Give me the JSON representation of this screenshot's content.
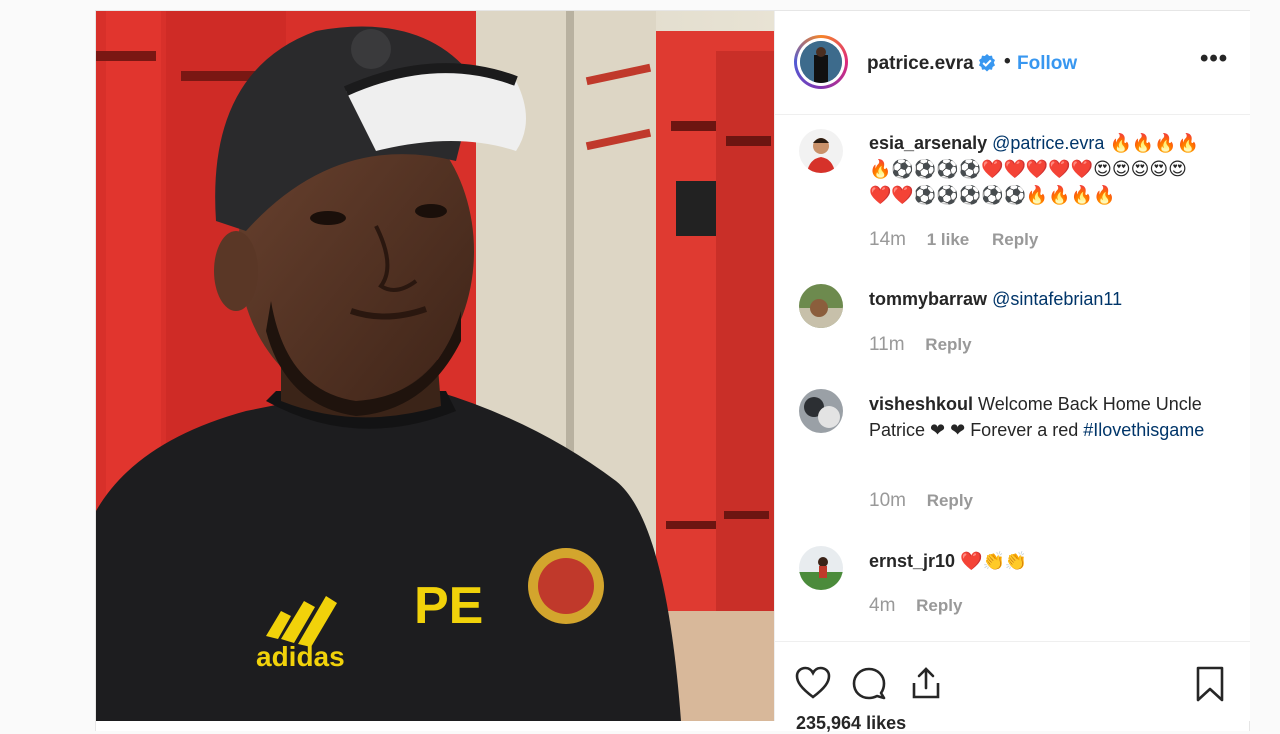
{
  "post": {
    "username": "patrice.evra",
    "follow_label": "Follow",
    "separator": "•",
    "more": "•••",
    "likes": "235,964 likes"
  },
  "comments": [
    {
      "user": "esia_arsenaly",
      "mention": "@patrice.evra",
      "text": " 🔥🔥🔥🔥 🔥⚽⚽⚽⚽❤️❤️❤️❤️❤️😍😍😍😍😍 ❤️❤️⚽⚽⚽⚽⚽🔥🔥🔥🔥",
      "time": "14m",
      "likes": "1 like",
      "reply": "Reply"
    },
    {
      "user": "tommybarraw",
      "mention": "@sintafebrian11",
      "text": "",
      "time": "11m",
      "reply": "Reply"
    },
    {
      "user": "visheshkoul",
      "text_before": " Welcome Back Home Uncle Patrice ❤ ❤ Forever a red ",
      "hashtag": "#Ilovethisgame",
      "time": "10m",
      "reply": "Reply"
    },
    {
      "user": "ernst_jr10",
      "text": " ❤️👏👏",
      "time": "4m",
      "reply": "Reply"
    }
  ],
  "photo": {
    "jersey_initials": "PE",
    "brand": "adidas"
  },
  "colors": {
    "link_blue": "#3897f0",
    "mention_navy": "#003569",
    "meta_gray": "#999999",
    "locker_red": "#e0332b"
  },
  "icons": [
    "heart-icon",
    "comment-icon",
    "share-icon",
    "bookmark-icon",
    "verified-icon",
    "more-icon"
  ]
}
